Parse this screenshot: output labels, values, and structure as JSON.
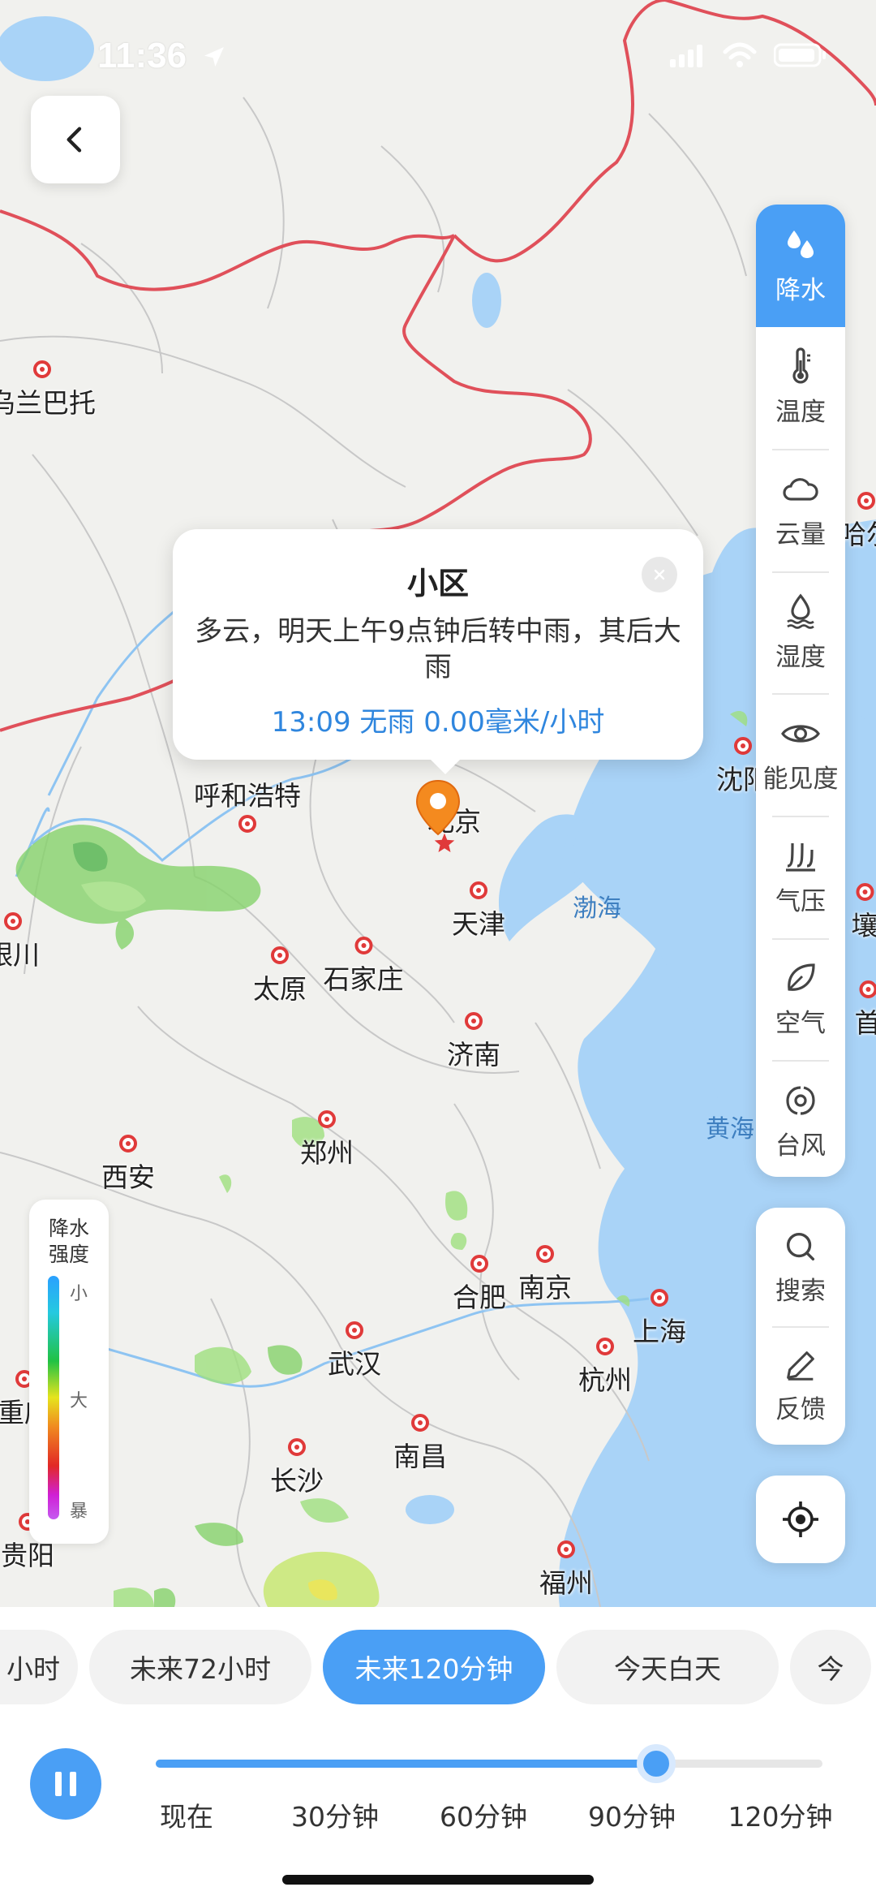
{
  "status_bar": {
    "time": "11:36"
  },
  "map": {
    "sea_labels": [
      "渤海",
      "黄海"
    ],
    "cities": [
      {
        "key": "wlbt",
        "name": "乌兰巴托"
      },
      {
        "key": "hhht",
        "name": "呼和浩特"
      },
      {
        "key": "bj",
        "name": "北京"
      },
      {
        "key": "tj",
        "name": "天津"
      },
      {
        "key": "ty",
        "name": "太原"
      },
      {
        "key": "sjz",
        "name": "石家庄"
      },
      {
        "key": "jn",
        "name": "济南"
      },
      {
        "key": "zz",
        "name": "郑州"
      },
      {
        "key": "xa",
        "name": "西安"
      },
      {
        "key": "yc",
        "name": "银川"
      },
      {
        "key": "hf",
        "name": "合肥"
      },
      {
        "key": "nj",
        "name": "南京"
      },
      {
        "key": "sh",
        "name": "上海"
      },
      {
        "key": "wh",
        "name": "武汉"
      },
      {
        "key": "hz",
        "name": "杭州"
      },
      {
        "key": "nc",
        "name": "南昌"
      },
      {
        "key": "cs",
        "name": "长沙"
      },
      {
        "key": "cq",
        "name": "重庆"
      },
      {
        "key": "gy",
        "name": "贵阳"
      },
      {
        "key": "fz",
        "name": "福州"
      },
      {
        "key": "sy",
        "name": "沈阳"
      },
      {
        "key": "heb",
        "name": "哈尔"
      },
      {
        "key": "rq",
        "name": "壤"
      },
      {
        "key": "sr",
        "name": "首"
      }
    ]
  },
  "layers": [
    {
      "label": "降水",
      "icon": "precipitation-icon",
      "active": true
    },
    {
      "label": "温度",
      "icon": "thermometer-icon",
      "active": false
    },
    {
      "label": "云量",
      "icon": "cloud-icon",
      "active": false
    },
    {
      "label": "湿度",
      "icon": "humidity-icon",
      "active": false
    },
    {
      "label": "能见度",
      "icon": "eye-icon",
      "active": false
    },
    {
      "label": "气压",
      "icon": "pressure-icon",
      "active": false
    },
    {
      "label": "空气",
      "icon": "leaf-icon",
      "active": false
    },
    {
      "label": "台风",
      "icon": "typhoon-icon",
      "active": false
    }
  ],
  "tools": {
    "search_label": "搜索",
    "feedback_label": "反馈"
  },
  "legend": {
    "title_line1": "降水",
    "title_line2": "强度",
    "ticks": [
      "小",
      "大",
      "暴"
    ]
  },
  "popup": {
    "title": "小区",
    "description": "多云，明天上午9点钟后转中雨，其后大雨",
    "meta": "13:09 无雨  0.00毫米/小时"
  },
  "tabs": [
    {
      "label": "小时",
      "active": false
    },
    {
      "label": "未来72小时",
      "active": false
    },
    {
      "label": "未来120分钟",
      "active": true
    },
    {
      "label": "今天白天",
      "active": false
    },
    {
      "label": "今",
      "active": false
    }
  ],
  "slider": {
    "progress": 0.75,
    "labels": [
      "现在",
      "30分钟",
      "60分钟",
      "90分钟",
      "120分钟"
    ]
  },
  "colors": {
    "accent": "#4a9ff5",
    "border_red": "#e0505a",
    "water": "#a9d3f7",
    "city_marker": "#e03a3a"
  }
}
